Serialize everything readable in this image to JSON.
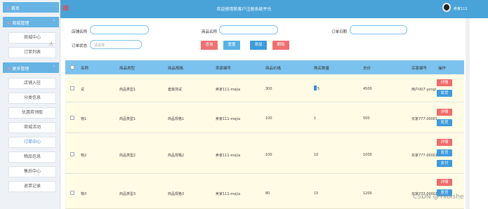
{
  "header": {
    "title": "欢迎使用新客户注册系统平台",
    "user": "卖家111"
  },
  "sidebar": {
    "home": "首页",
    "groups": [
      {
        "label": "商城管理",
        "items": [
          "商城中心",
          "订单列表"
        ]
      },
      {
        "label": "更多管理",
        "items": [
          "店铺入驻",
          "分类信息",
          "优惠券领取",
          "商城活动",
          "订单中心",
          "物品信息",
          "售后中心",
          "退单记录"
        ]
      }
    ],
    "active_item": "订单中心"
  },
  "search": {
    "shop_label": "店铺名称",
    "product_label": "商品名称",
    "order_date_label": "订单日期",
    "status_label": "订单状态",
    "status_placeholder": "请选择",
    "query": "查询",
    "reset": "重置",
    "add": "添加",
    "delete": "删除"
  },
  "table": {
    "columns": [
      "名称",
      "商品类型",
      "商品规格",
      "卖家编号",
      "商品价格",
      "购买数量",
      "总价",
      "买家编号",
      "操作"
    ],
    "rows": [
      {
        "name": "试",
        "type": "商品类型1",
        "spec": "套装测试",
        "seller": "卖家111-mejia",
        "price": "300",
        "qty": "5",
        "total": "4500",
        "buyer": "用户007-yongl",
        "actions": [
          "详情",
          "发货"
        ]
      },
      {
        "name": "物1",
        "type": "商品类型1",
        "spec": "商品规格1",
        "seller": "卖家111-mejia",
        "price": "100",
        "qty": "1",
        "total": "500",
        "buyer": "买家777-00001",
        "actions": [
          "详情",
          "发货"
        ]
      },
      {
        "name": "物2",
        "type": "商品类型2",
        "spec": "商品规格2",
        "seller": "卖家111-mejia",
        "price": "100",
        "qty": "10",
        "total": "1000",
        "buyer": "买家777-00001",
        "actions": [
          "详情",
          "发货",
          "支付"
        ]
      },
      {
        "name": "物3",
        "type": "商品类型3",
        "spec": "商品规格3",
        "seller": "卖家111-mejia",
        "price": "80",
        "qty": "15",
        "total": "1200",
        "buyer": "买家777-00001",
        "actions": [
          "详情",
          "发货"
        ]
      }
    ]
  },
  "watermark": "CSDN @Yxbishe",
  "colors": {
    "topbar": "#4aa3d8",
    "header_row": "#7cc2ee",
    "row_bg": "#fffbe4",
    "danger": "#ef6b6b",
    "primary": "#3d9bdc"
  }
}
